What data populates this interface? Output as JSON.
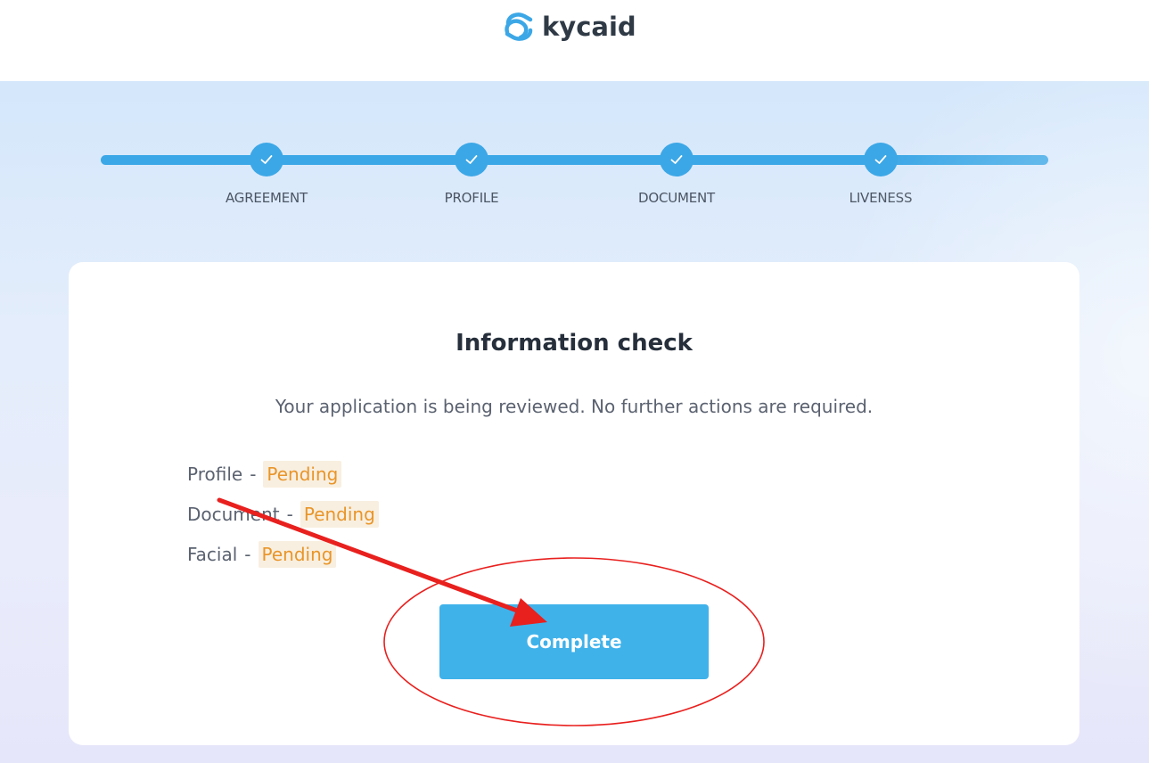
{
  "brand": {
    "name": "kycaid",
    "color": "#2f3a46",
    "mark_color": "#3ca7e6"
  },
  "stepper": {
    "accent": "#3ca7e6",
    "steps": [
      {
        "label": "AGREEMENT",
        "icon": "check-icon",
        "done": true
      },
      {
        "label": "PROFILE",
        "icon": "check-icon",
        "done": true
      },
      {
        "label": "DOCUMENT",
        "icon": "check-icon",
        "done": true
      },
      {
        "label": "LIVENESS",
        "icon": "check-icon",
        "done": true
      }
    ]
  },
  "card": {
    "title": "Information check",
    "description": "Your application is being reviewed. No further actions are required.",
    "separator": "-",
    "statuses": [
      {
        "name": "Profile",
        "status": "Pending"
      },
      {
        "name": "Document",
        "status": "Pending"
      },
      {
        "name": "Facial",
        "status": "Pending"
      }
    ],
    "status_color": "#e99529",
    "button_label": "Complete",
    "button_color": "#3fb2ea"
  },
  "annotation": {
    "color": "#e8201e",
    "shapes": [
      "arrow",
      "ellipse"
    ]
  }
}
